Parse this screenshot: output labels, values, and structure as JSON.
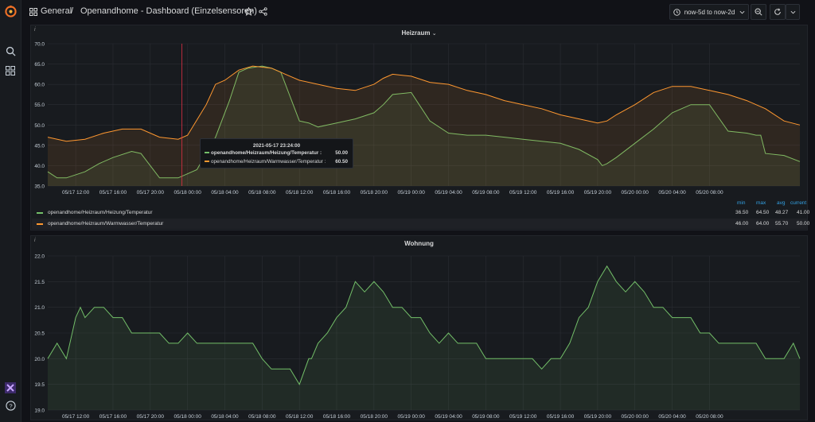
{
  "colors": {
    "green": "#73bf69",
    "orange": "#ff9830",
    "accent": "#33a2e5",
    "bg": "#111217",
    "panel": "#181b1f"
  },
  "header": {
    "folder": "General",
    "separator": "/",
    "dashboard_title": "Openandhome - Dashboard (Einzelsensoren)",
    "time_range": "now-5d to now-2d"
  },
  "sidebar": {
    "icons": [
      "grafana-logo-icon",
      "search-icon",
      "dashboards-icon",
      "user-avatar-icon",
      "help-icon"
    ],
    "help_label": "?"
  },
  "panel_heizraum": {
    "title": "Heizraum",
    "info": "i",
    "legend_headers": {
      "min": "min",
      "max": "max",
      "avg": "avg",
      "current": "current"
    },
    "legend": [
      {
        "name": "openandhome/Heizraum/Heizung/Temperatur",
        "min": "36.50",
        "max": "64.50",
        "avg": "48.27",
        "current": "41.00"
      },
      {
        "name": "openandhome/Heizraum/Warmwasser/Temperatur",
        "min": "46.00",
        "max": "64.00",
        "avg": "55.70",
        "current": "50.00"
      }
    ],
    "tooltip": {
      "time": "2021-05-17 23:24:00",
      "rows": [
        {
          "name": "openandhome/Heizraum/Heizung/Temperatur :",
          "value": "50.00"
        },
        {
          "name": "openandhome/Heizraum/Warmwasser/Temperatur :",
          "value": "60.50"
        }
      ]
    }
  },
  "panel_wohnung": {
    "title": "Wohnung",
    "info": "i"
  },
  "chart_data": [
    {
      "type": "line",
      "title": "Heizraum",
      "x_ticks": [
        "05/17 12:00",
        "05/17 16:00",
        "05/17 20:00",
        "05/18 00:00",
        "05/18 04:00",
        "05/18 08:00",
        "05/18 12:00",
        "05/18 16:00",
        "05/18 20:00",
        "05/19 00:00",
        "05/19 04:00",
        "05/19 08:00",
        "05/19 12:00",
        "05/19 16:00",
        "05/19 20:00",
        "05/20 00:00",
        "05/20 04:00",
        "05/20 08:00"
      ],
      "y_ticks": [
        "35.0",
        "40.0",
        "45.0",
        "50.0",
        "55.0",
        "60.0",
        "65.0",
        "70.0"
      ],
      "ylim": [
        35,
        70
      ],
      "xlim": [
        9.0,
        89.7
      ],
      "series": [
        {
          "name": "openandhome/Heizraum/Heizung/Temperatur",
          "color": "#73bf69",
          "x": [
            9.0,
            10.0,
            11.0,
            13.0,
            14.5,
            16.0,
            18.0,
            19.0,
            20.0,
            21.0,
            23.0,
            25.0,
            27.0,
            28.5,
            29.5,
            30.5,
            32.0,
            33.0,
            34.0,
            35.0,
            36.0,
            37.0,
            38.0,
            39.0,
            40.0,
            42.0,
            44.0,
            45.0,
            46.0,
            48.0,
            50.0,
            52.0,
            54.0,
            56.0,
            58.0,
            60.0,
            62.0,
            64.0,
            66.0,
            68.0,
            68.5,
            69.0,
            70.0,
            72.0,
            74.0,
            76.0,
            78.0,
            80.0,
            82.0,
            84.0,
            85.0,
            85.5,
            86.0,
            88.0,
            89.7
          ],
          "y": [
            38.5,
            37.0,
            37.0,
            38.5,
            40.5,
            42.0,
            43.5,
            43.0,
            40.0,
            37.0,
            37.0,
            39.0,
            47.0,
            56.0,
            63.0,
            64.0,
            64.5,
            64.0,
            63.0,
            57.0,
            51.0,
            50.5,
            49.5,
            50.0,
            50.5,
            51.5,
            53.0,
            55.0,
            57.5,
            58.0,
            51.0,
            48.0,
            47.5,
            47.5,
            47.0,
            46.5,
            46.0,
            45.5,
            44.0,
            41.5,
            40.0,
            40.5,
            42.0,
            45.5,
            49.0,
            53.0,
            55.0,
            55.0,
            48.5,
            48.0,
            47.5,
            47.5,
            43.0,
            42.5,
            41.0
          ]
        },
        {
          "name": "openandhome/Heizraum/Warmwasser/Temperatur",
          "color": "#ff9830",
          "x": [
            9.0,
            11.0,
            13.0,
            15.0,
            17.0,
            19.0,
            21.0,
            23.0,
            24.0,
            26.0,
            27.0,
            28.0,
            29.5,
            31.0,
            33.0,
            34.5,
            36.0,
            38.0,
            40.0,
            42.0,
            44.0,
            45.0,
            46.0,
            48.0,
            50.0,
            52.0,
            54.0,
            56.0,
            58.0,
            60.0,
            62.0,
            64.0,
            66.0,
            68.0,
            69.0,
            70.0,
            72.0,
            74.0,
            76.0,
            78.0,
            80.0,
            82.0,
            84.0,
            86.0,
            88.0,
            89.7
          ],
          "y": [
            47.0,
            46.0,
            46.5,
            48.0,
            49.0,
            49.0,
            47.0,
            46.5,
            47.5,
            55.0,
            60.0,
            61.0,
            63.5,
            64.5,
            64.0,
            62.5,
            61.0,
            60.0,
            59.0,
            58.5,
            60.0,
            61.5,
            62.5,
            62.0,
            60.5,
            60.0,
            58.5,
            57.5,
            56.0,
            55.0,
            54.0,
            52.5,
            51.5,
            50.5,
            51.0,
            52.5,
            55.0,
            58.0,
            59.5,
            59.5,
            58.5,
            57.5,
            56.0,
            54.0,
            51.0,
            50.0
          ]
        }
      ]
    },
    {
      "type": "line",
      "title": "Wohnung",
      "x_ticks": [
        "05/17 12:00",
        "05/17 16:00",
        "05/17 20:00",
        "05/18 00:00",
        "05/18 04:00",
        "05/18 08:00",
        "05/18 12:00",
        "05/18 16:00",
        "05/18 20:00",
        "05/19 00:00",
        "05/19 04:00",
        "05/19 08:00",
        "05/19 12:00",
        "05/19 16:00",
        "05/19 20:00",
        "05/20 00:00",
        "05/20 04:00",
        "05/20 08:00"
      ],
      "y_ticks": [
        "19.0",
        "19.5",
        "20.0",
        "20.5",
        "21.0",
        "21.5",
        "22.0"
      ],
      "ylim": [
        19.0,
        22.0
      ],
      "xlim": [
        9.0,
        89.7
      ],
      "series": [
        {
          "name": "Wohnung",
          "color": "#73bf69",
          "x": [
            9.0,
            10.0,
            11.0,
            12.0,
            12.5,
            13.0,
            14.0,
            15.0,
            16.0,
            17.0,
            18.0,
            19.0,
            21.0,
            22.0,
            23.0,
            24.0,
            25.0,
            26.0,
            27.0,
            28.0,
            29.0,
            30.0,
            31.0,
            32.0,
            33.0,
            35.0,
            36.0,
            37.0,
            37.3,
            38.0,
            39.0,
            40.0,
            41.0,
            42.0,
            43.0,
            44.0,
            45.0,
            46.0,
            47.0,
            48.0,
            49.0,
            50.0,
            51.0,
            52.0,
            53.0,
            55.0,
            56.0,
            57.0,
            58.0,
            60.0,
            61.0,
            62.0,
            63.0,
            64.0,
            65.0,
            66.0,
            67.0,
            68.0,
            69.0,
            70.0,
            71.0,
            72.0,
            73.0,
            74.0,
            75.0,
            76.0,
            77.0,
            78.0,
            79.0,
            80.0,
            81.0,
            82.0,
            83.0,
            85.0,
            86.0,
            87.0,
            88.0,
            89.0,
            89.7
          ],
          "y": [
            20.0,
            20.3,
            20.0,
            20.8,
            21.0,
            20.8,
            21.0,
            21.0,
            20.8,
            20.8,
            20.5,
            20.5,
            20.5,
            20.3,
            20.3,
            20.5,
            20.3,
            20.3,
            20.3,
            20.3,
            20.3,
            20.3,
            20.3,
            20.0,
            19.8,
            19.8,
            19.5,
            20.0,
            20.0,
            20.3,
            20.5,
            20.8,
            21.0,
            21.5,
            21.3,
            21.5,
            21.3,
            21.0,
            21.0,
            20.8,
            20.8,
            20.5,
            20.3,
            20.5,
            20.3,
            20.3,
            20.0,
            20.0,
            20.0,
            20.0,
            20.0,
            19.8,
            20.0,
            20.0,
            20.3,
            20.8,
            21.0,
            21.5,
            21.8,
            21.5,
            21.3,
            21.5,
            21.3,
            21.0,
            21.0,
            20.8,
            20.8,
            20.8,
            20.5,
            20.5,
            20.3,
            20.3,
            20.3,
            20.3,
            20.0,
            20.0,
            20.0,
            20.3,
            20.0
          ]
        }
      ]
    }
  ]
}
